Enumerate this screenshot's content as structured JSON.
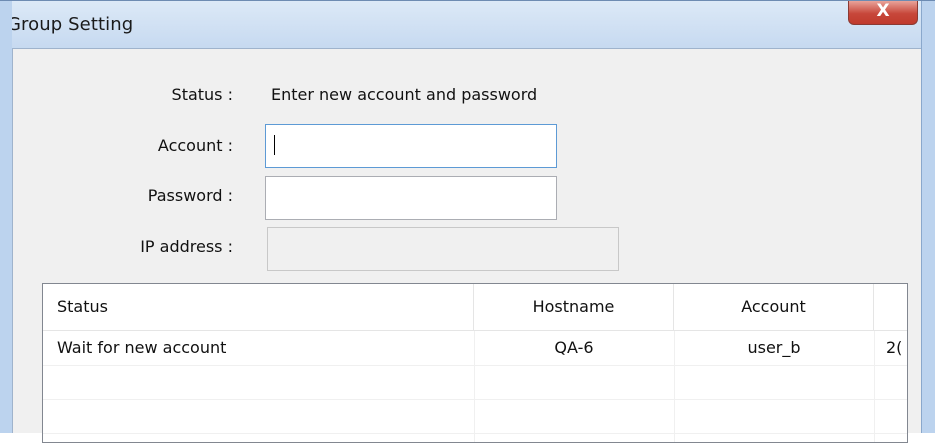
{
  "window": {
    "title": "Group Setting",
    "close_label": "X"
  },
  "form": {
    "status_label": "Status :",
    "status_value": "Enter new account and password",
    "account_label": "Account :",
    "account_value": "",
    "password_label": "Password :",
    "password_value": "",
    "ip_label": "IP address :",
    "ip_value": ""
  },
  "table": {
    "headers": [
      "Status",
      "Hostname",
      "Account",
      ""
    ],
    "rows": [
      [
        "Wait for new account",
        "QA-6",
        "user_b",
        "2("
      ]
    ]
  }
}
